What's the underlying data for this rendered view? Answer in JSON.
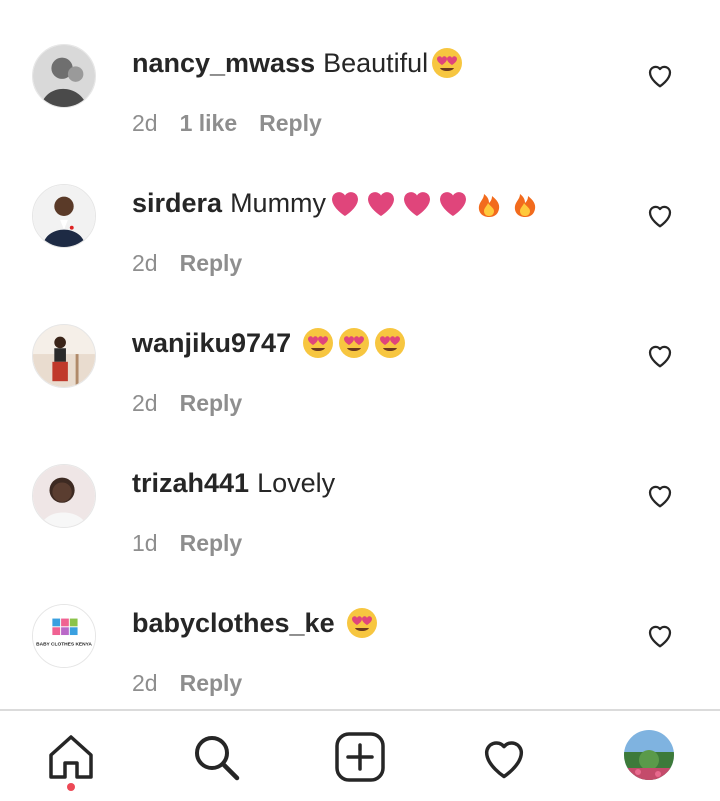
{
  "comments": [
    {
      "username": "nancy_mwass",
      "text": "Beautiful",
      "emojis": [
        "heart-eyes-emoji"
      ],
      "time": "2d",
      "likes": "1 like",
      "reply": "Reply"
    },
    {
      "username": "sirdera",
      "text": "Mummy",
      "emojis": [
        "pink-heart-emoji",
        "pink-heart-emoji",
        "pink-heart-emoji",
        "pink-heart-emoji",
        "fire-emoji",
        "fire-emoji"
      ],
      "time": "2d",
      "likes": null,
      "reply": "Reply"
    },
    {
      "username": "wanjiku9747",
      "text": "",
      "emojis": [
        "heart-eyes-emoji",
        "heart-eyes-emoji",
        "heart-eyes-emoji"
      ],
      "time": "2d",
      "likes": null,
      "reply": "Reply"
    },
    {
      "username": "trizah441",
      "text": "Lovely",
      "emojis": [],
      "time": "1d",
      "likes": null,
      "reply": "Reply"
    },
    {
      "username": "babyclothes_ke",
      "text": "",
      "emojis": [
        "heart-eyes-emoji"
      ],
      "time": "2d",
      "likes": null,
      "reply": "Reply",
      "avatar_text": "BABY CLOTHES KENYA"
    }
  ],
  "nav": {
    "items": [
      "home-icon",
      "search-icon",
      "new-post-icon",
      "activity-heart-icon",
      "profile-avatar"
    ],
    "notification_dot_color": "#ed4956"
  },
  "colors": {
    "heart_emoji": "#e0457b",
    "meta_text": "#8e8e8e",
    "username": "#262626"
  }
}
